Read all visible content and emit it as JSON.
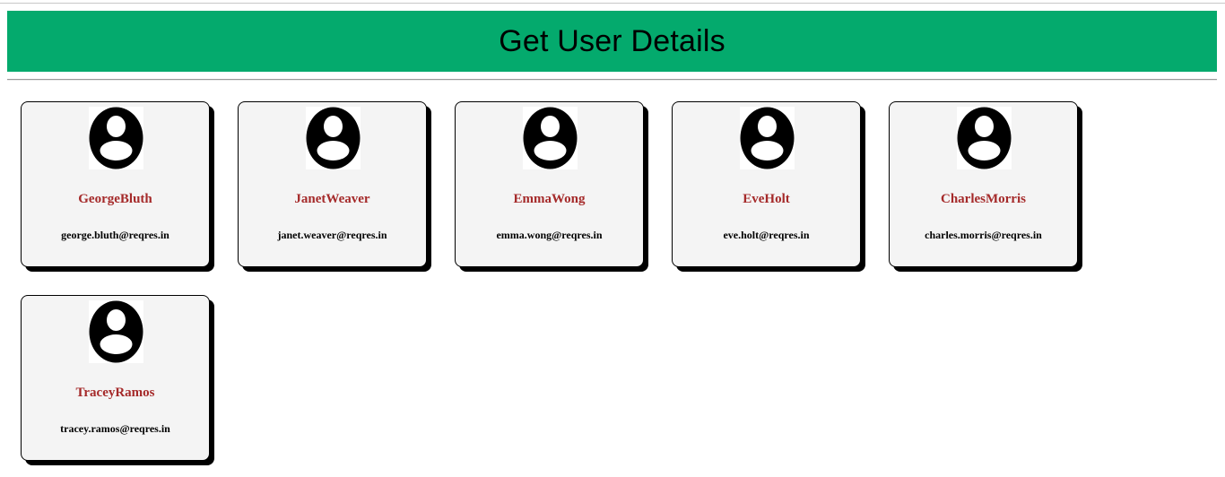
{
  "page": {
    "title": "Get User Details"
  },
  "users": [
    {
      "name": "GeorgeBluth",
      "email": "george.bluth@reqres.in",
      "avatar_icon": "user-avatar-icon"
    },
    {
      "name": "JanetWeaver",
      "email": "janet.weaver@reqres.in",
      "avatar_icon": "user-avatar-icon"
    },
    {
      "name": "EmmaWong",
      "email": "emma.wong@reqres.in",
      "avatar_icon": "user-avatar-icon"
    },
    {
      "name": "EveHolt",
      "email": "eve.holt@reqres.in",
      "avatar_icon": "user-avatar-icon"
    },
    {
      "name": "CharlesMorris",
      "email": "charles.morris@reqres.in",
      "avatar_icon": "user-avatar-icon"
    },
    {
      "name": "TraceyRamos",
      "email": "tracey.ramos@reqres.in",
      "avatar_icon": "user-avatar-icon"
    }
  ],
  "colors": {
    "header_bg": "#04aa6d",
    "name_text": "#a52a2a",
    "card_bg": "#f4f4f4"
  }
}
